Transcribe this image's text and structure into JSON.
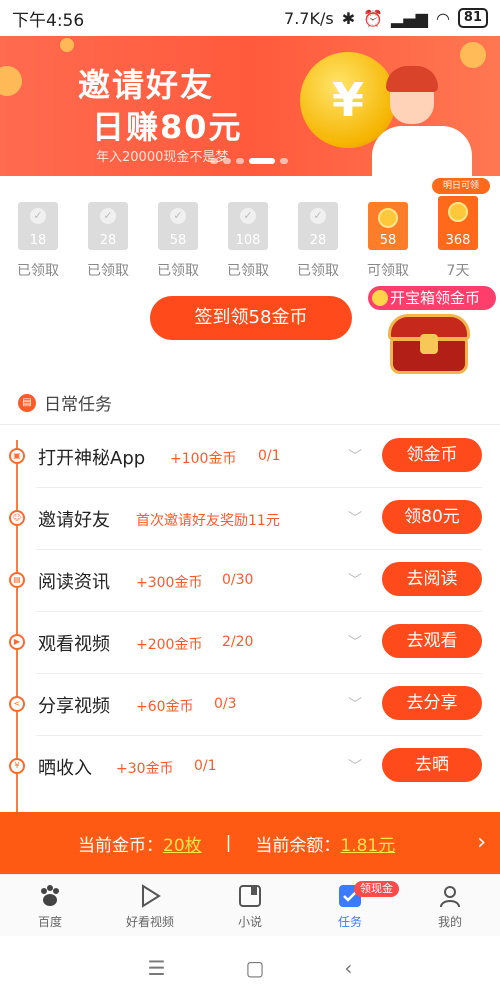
{
  "status_bar": {
    "time": "下午4:56",
    "speed": "7.7K/s",
    "battery": "81"
  },
  "banner": {
    "line1": "邀请好友",
    "line2": "日赚80元",
    "line3": "年入20000现金不是梦",
    "coin_symbol": "¥"
  },
  "checkin": {
    "days": [
      {
        "value": "18",
        "label": "已领取",
        "state": "claimed"
      },
      {
        "value": "28",
        "label": "已领取",
        "state": "claimed"
      },
      {
        "value": "58",
        "label": "已领取",
        "state": "claimed"
      },
      {
        "value": "108",
        "label": "已领取",
        "state": "claimed"
      },
      {
        "value": "28",
        "label": "已领取",
        "state": "claimed"
      },
      {
        "value": "58",
        "label": "可领取",
        "state": "available"
      },
      {
        "value": "368",
        "label": "7天",
        "state": "future"
      }
    ],
    "tomorrow_tag": "明日可领",
    "signin_button": "签到领58金币",
    "chest_label": "开宝箱领金币"
  },
  "daily_tasks": {
    "title": "日常任务",
    "items": [
      {
        "name": "打开神秘App",
        "reward": "+100金币",
        "progress": "0/1",
        "button": "领金币"
      },
      {
        "name": "邀请好友",
        "reward": "首次邀请好友奖励11元",
        "progress": "",
        "button": "领80元"
      },
      {
        "name": "阅读资讯",
        "reward": "+300金币",
        "progress": "0/30",
        "button": "去阅读"
      },
      {
        "name": "观看视频",
        "reward": "+200金币",
        "progress": "2/20",
        "button": "去观看"
      },
      {
        "name": "分享视频",
        "reward": "+60金币",
        "progress": "0/3",
        "button": "去分享"
      },
      {
        "name": "晒收入",
        "reward": "+30金币",
        "progress": "0/1",
        "button": "去晒"
      }
    ]
  },
  "balance_bar": {
    "coins_label": "当前金币：",
    "coins_value": "20枚",
    "separator": "|",
    "balance_label": "当前余额：",
    "balance_value": "1.81元"
  },
  "bottom_nav": {
    "items": [
      {
        "label": "百度",
        "icon": "baidu-paw-icon"
      },
      {
        "label": "好看视频",
        "icon": "play-icon"
      },
      {
        "label": "小说",
        "icon": "book-icon"
      },
      {
        "label": "任务",
        "icon": "task-check-icon"
      },
      {
        "label": "我的",
        "icon": "person-icon"
      }
    ],
    "task_badge": "领现金"
  },
  "colors": {
    "accent": "#ff4a1c",
    "bar": "#ff5a14",
    "nav_active": "#3b7bff"
  }
}
